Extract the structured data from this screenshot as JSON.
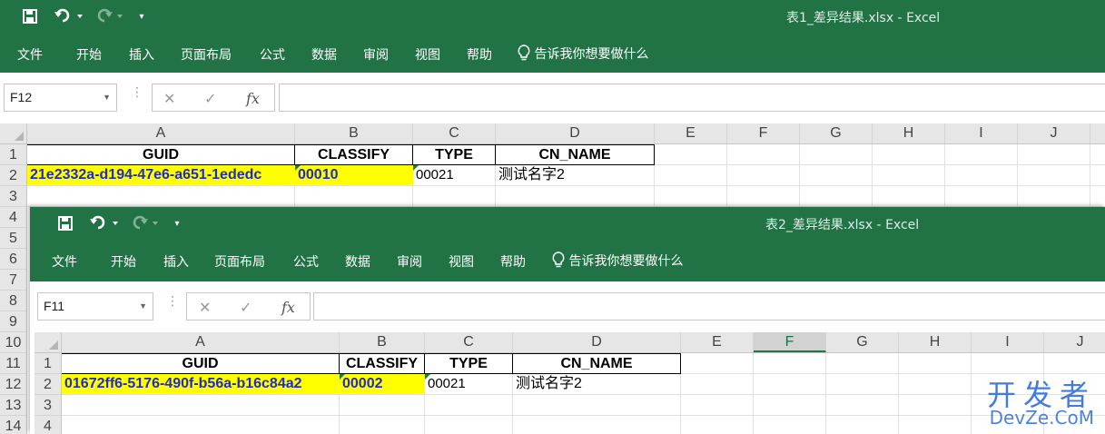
{
  "w1": {
    "title": "表1_差异结果.xlsx  -  Excel",
    "tabs": [
      "文件",
      "开始",
      "插入",
      "页面布局",
      "公式",
      "数据",
      "审阅",
      "视图",
      "帮助"
    ],
    "tellme": "告诉我你想要做什么",
    "namebox": "F12",
    "cols": [
      "A",
      "B",
      "C",
      "D",
      "E",
      "F",
      "G",
      "H",
      "I",
      "J"
    ],
    "rows": [
      "1",
      "2",
      "3",
      "4",
      "5",
      "6",
      "7",
      "8",
      "9",
      "10",
      "11",
      "12",
      "13",
      "14"
    ],
    "headers": [
      "GUID",
      "CLASSIFY",
      "TYPE",
      "CN_NAME"
    ],
    "row2": [
      "21e2332a-d194-47e6-a651-1ededc",
      "00010",
      "00021",
      "测试名字2"
    ]
  },
  "w2": {
    "title": "表2_差异结果.xlsx  -  Excel",
    "tabs": [
      "文件",
      "开始",
      "插入",
      "页面布局",
      "公式",
      "数据",
      "审阅",
      "视图",
      "帮助"
    ],
    "tellme": "告诉我你想要做什么",
    "namebox": "F11",
    "cols": [
      "A",
      "B",
      "C",
      "D",
      "E",
      "F",
      "G",
      "H",
      "I",
      "J"
    ],
    "rows": [
      "1",
      "2",
      "3",
      "4"
    ],
    "headers": [
      "GUID",
      "CLASSIFY",
      "TYPE",
      "CN_NAME"
    ],
    "row2": [
      "01672ff6-5176-490f-b56a-b16c84a2",
      "00002",
      "00021",
      "测试名字2"
    ]
  },
  "watermark": {
    "cn": "开发者",
    "en": "DevZe.CoM"
  },
  "icons": {
    "save": "save-icon",
    "undo": "undo-icon",
    "redo": "redo-icon",
    "customize": "customize-icon",
    "bulb": "lightbulb-icon",
    "cancel": "cancel-icon",
    "enter": "checkmark-icon",
    "fx": "fx-icon"
  },
  "colors": {
    "ribbon": "#217346",
    "highlight": "#ffff00",
    "text_blue": "#1f2bc8"
  }
}
